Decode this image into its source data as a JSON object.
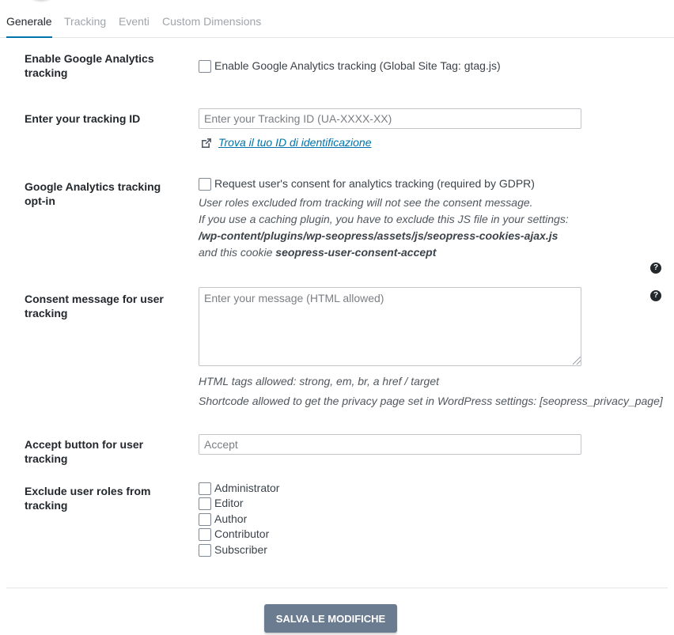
{
  "tabs": [
    {
      "label": "Generale",
      "active": true
    },
    {
      "label": "Tracking",
      "active": false
    },
    {
      "label": "Eventi",
      "active": false
    },
    {
      "label": "Custom Dimensions",
      "active": false
    }
  ],
  "enable_ga": {
    "label": "Enable Google Analytics tracking",
    "checkbox_label": "Enable Google Analytics tracking (Global Site Tag: gtag.js)",
    "checked": false
  },
  "tracking_id": {
    "label": "Enter your tracking ID",
    "value": "",
    "placeholder": "Enter your Tracking ID (UA-XXXX-XX)",
    "link_text": "Trova il tuo ID di identificazione",
    "link_icon": "external-link-icon"
  },
  "opt_in": {
    "label": "Google Analytics tracking opt-in",
    "checkbox_label": "Request user's consent for analytics tracking (required by GDPR)",
    "checked": false,
    "desc_1": "User roles excluded from tracking will not see the consent message.",
    "desc_2": "If you use a caching plugin, you have to exclude this JS file in your settings:",
    "desc_path": "/wp-content/plugins/wp-seopress/assets/js/seopress-cookies-ajax.js",
    "desc_cookie_prefix": "and this cookie",
    "desc_cookie_name": "seopress-user-consent-accept"
  },
  "consent_message": {
    "label": "Consent message for user tracking",
    "value": "",
    "placeholder": "Enter your message (HTML allowed)",
    "desc_1": "HTML tags allowed: strong, em, br, a href / target",
    "desc_2": "Shortcode allowed to get the privacy page set in WordPress settings: [seopress_privacy_page]"
  },
  "accept_button": {
    "label": "Accept button for user tracking",
    "value": "",
    "placeholder": "Accept"
  },
  "exclude_roles": {
    "label": "Exclude user roles from tracking",
    "roles": [
      {
        "label": "Administrator",
        "checked": false
      },
      {
        "label": "Editor",
        "checked": false
      },
      {
        "label": "Author",
        "checked": false
      },
      {
        "label": "Contributor",
        "checked": false
      },
      {
        "label": "Subscriber",
        "checked": false
      }
    ]
  },
  "help_icon_text": "?",
  "save_button": "SALVA LE MODIFICHE",
  "colors": {
    "active_tab_underline": "#0073aa",
    "link": "#0073aa",
    "save_button_bg": "#6b7c90"
  }
}
